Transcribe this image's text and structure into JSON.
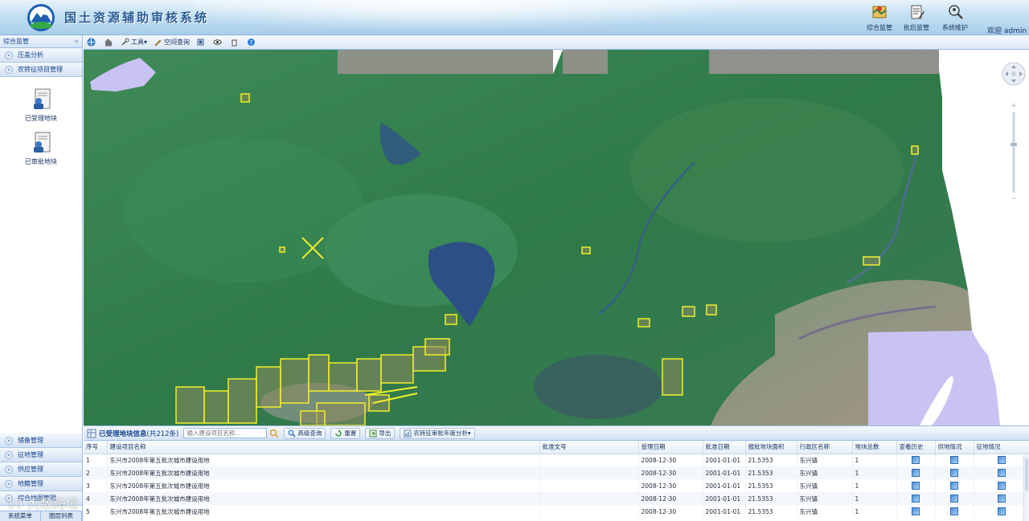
{
  "header": {
    "title": "国土资源辅助审核系统",
    "nav": [
      {
        "label": "综合监管",
        "icon": "map-monitor-icon"
      },
      {
        "label": "批后监管",
        "icon": "document-edit-icon"
      },
      {
        "label": "系统维护",
        "icon": "magnifier-person-icon"
      }
    ],
    "welcome": "欢迎 admin"
  },
  "sidebar": {
    "title": "综合监管",
    "collapse_glyph": "«",
    "top_items": [
      {
        "label": "压盖分析",
        "chev": "»"
      },
      {
        "label": "农转征项目管理",
        "chev": "«"
      }
    ],
    "tiles": [
      {
        "label": "已受理地块",
        "icon": "parcel-received-icon"
      },
      {
        "label": "已审批地块",
        "icon": "parcel-approved-icon"
      }
    ],
    "bottom_items": [
      {
        "label": "储备管理"
      },
      {
        "label": "征地管理"
      },
      {
        "label": "供应管理"
      },
      {
        "label": "地籍管理"
      },
      {
        "label": "综合地图管理"
      }
    ],
    "bottom_tabs": [
      "系统菜单",
      "图层列表"
    ]
  },
  "map_toolbar": {
    "items": [
      {
        "label": "",
        "icon": "globe-icon"
      },
      {
        "label": "",
        "icon": "pan-hand-icon"
      },
      {
        "label": "工具▾",
        "icon": "tools-icon"
      },
      {
        "label": "空间查询",
        "icon": "pencil-query-icon"
      },
      {
        "label": "",
        "icon": "print-icon"
      },
      {
        "label": "",
        "icon": "eye-icon"
      },
      {
        "label": "",
        "icon": "clear-icon"
      },
      {
        "label": "",
        "icon": "help-icon"
      }
    ]
  },
  "grid": {
    "title": "已受理地块信息",
    "count": "(共212条)",
    "search_placeholder": "输入建设项目名称...",
    "buttons": [
      {
        "label": "高级查询",
        "icon": "advanced-search-icon"
      },
      {
        "label": "重置",
        "icon": "reset-icon"
      },
      {
        "label": "导出",
        "icon": "export-icon"
      },
      {
        "label": "农转征审批年度分析▾",
        "icon": "analysis-icon"
      }
    ],
    "columns": [
      "序号",
      "建设项目名称",
      "批准文号",
      "受理日期",
      "批准日期",
      "报批地块面积",
      "行政区名称",
      "地块总数",
      "查看历史",
      "供地情况",
      "征地情况"
    ],
    "rows": [
      {
        "no": "1",
        "name": "东兴市2008年第五批次城市建设用地",
        "approval_no": "",
        "accept_date": "2008-12-30",
        "approve_date": "2001-01-01",
        "area": "21.5353",
        "district": "东兴镇",
        "total": "1"
      },
      {
        "no": "2",
        "name": "东兴市2008年第五批次城市建设用地",
        "approval_no": "",
        "accept_date": "2008-12-30",
        "approve_date": "2001-01-01",
        "area": "21.5353",
        "district": "东兴镇",
        "total": "1"
      },
      {
        "no": "3",
        "name": "东兴市2008年第五批次城市建设用地",
        "approval_no": "",
        "accept_date": "2008-12-30",
        "approve_date": "2001-01-01",
        "area": "21.5353",
        "district": "东兴镇",
        "total": "1"
      },
      {
        "no": "4",
        "name": "东兴市2008年第五批次城市建设用地",
        "approval_no": "",
        "accept_date": "2008-12-30",
        "approve_date": "2001-01-01",
        "area": "21.5353",
        "district": "东兴镇",
        "total": "1"
      },
      {
        "no": "5",
        "name": "东兴市2008年第五批次城市建设用地",
        "approval_no": "",
        "accept_date": "2008-12-30",
        "approve_date": "2001-01-01",
        "area": "21.5353",
        "district": "东兴镇",
        "total": "1"
      }
    ]
  },
  "watermark": "10 大数跨境",
  "colors": {
    "header_blue": "#a9cdea",
    "panel_border": "#99bbe8",
    "parcel_yellow": "#f2ef2a",
    "sea_lavender": "#c9c3f3",
    "forest_green": "#2f7a45"
  }
}
